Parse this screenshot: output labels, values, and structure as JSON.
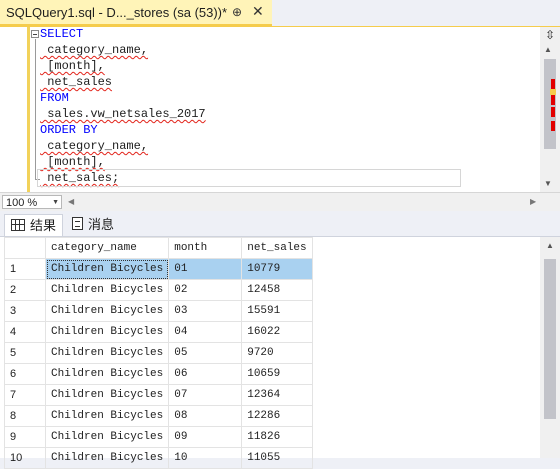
{
  "tab": {
    "title": "SQLQuery1.sql - D..._stores (sa (53))*",
    "pin": "⊕",
    "close": "✕"
  },
  "editor": {
    "lines": [
      {
        "kw": "SELECT",
        "text": ""
      },
      {
        "kw": "",
        "text": " category_name,"
      },
      {
        "kw": "",
        "text": " [month],"
      },
      {
        "kw": "",
        "text": " net_sales"
      },
      {
        "kw": "FROM",
        "text": ""
      },
      {
        "kw": "",
        "text": " sales.vw_netsales_2017"
      },
      {
        "kw": "ORDER BY",
        "text": ""
      },
      {
        "kw": "",
        "text": " category_name,"
      },
      {
        "kw": "",
        "text": " [month],"
      },
      {
        "kw": "",
        "text": " net_sales;"
      }
    ]
  },
  "zoom": {
    "value": "100 %"
  },
  "result_tabs": {
    "results": "结果",
    "messages": "消息"
  },
  "grid": {
    "columns": [
      "category_name",
      "month",
      "net_sales"
    ],
    "rows": [
      {
        "n": "1",
        "category": "Children Bicycles",
        "month": "01",
        "sales": "10779"
      },
      {
        "n": "2",
        "category": "Children Bicycles",
        "month": "02",
        "sales": "12458"
      },
      {
        "n": "3",
        "category": "Children Bicycles",
        "month": "03",
        "sales": "15591"
      },
      {
        "n": "4",
        "category": "Children Bicycles",
        "month": "04",
        "sales": "16022"
      },
      {
        "n": "5",
        "category": "Children Bicycles",
        "month": "05",
        "sales": "9720"
      },
      {
        "n": "6",
        "category": "Children Bicycles",
        "month": "06",
        "sales": "10659"
      },
      {
        "n": "7",
        "category": "Children Bicycles",
        "month": "07",
        "sales": "12364"
      },
      {
        "n": "8",
        "category": "Children Bicycles",
        "month": "08",
        "sales": "12286"
      },
      {
        "n": "9",
        "category": "Children Bicycles",
        "month": "09",
        "sales": "11826"
      },
      {
        "n": "10",
        "category": "Children Bicycles",
        "month": "10",
        "sales": "11055"
      }
    ]
  },
  "colors": {
    "accent_tab": "#fff4b8",
    "selection": "#a9d1f0",
    "keyword": "#0000ff"
  }
}
